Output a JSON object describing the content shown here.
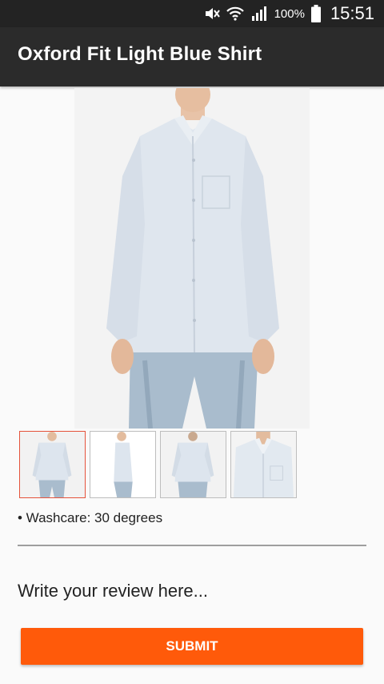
{
  "status_bar": {
    "battery_text": "100%",
    "time": "15:51",
    "icons": [
      "mute-icon",
      "wifi-icon",
      "signal-icon",
      "battery-icon"
    ]
  },
  "app_bar": {
    "title": "Oxford Fit Light Blue Shirt"
  },
  "product": {
    "main_image_icon": "shirt-model-photo",
    "thumbnails": [
      {
        "icon": "front-view-thumbnail",
        "selected": true
      },
      {
        "icon": "side-view-thumbnail",
        "selected": false
      },
      {
        "icon": "back-view-thumbnail",
        "selected": false
      },
      {
        "icon": "collar-closeup-thumbnail",
        "selected": false
      }
    ],
    "washcare": "• Washcare: 30 degrees"
  },
  "review": {
    "placeholder": "Write your review here...",
    "value": ""
  },
  "submit_label": "SUBMIT",
  "colors": {
    "status_bar": "#232323",
    "app_bar": "#2b2b2b",
    "accent": "#ff5a0a",
    "thumb_selected_border": "#e5533b"
  }
}
